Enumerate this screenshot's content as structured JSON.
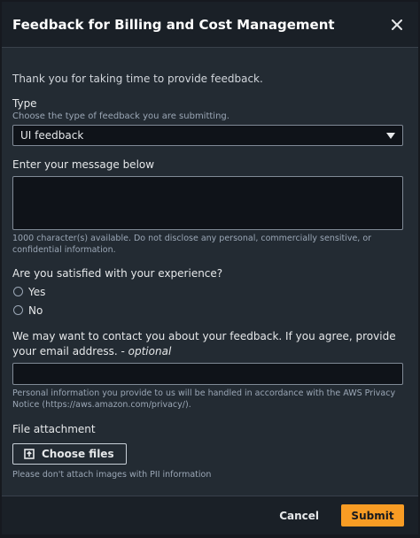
{
  "dialog": {
    "title": "Feedback for Billing and Cost Management",
    "intro": "Thank you for taking time to provide feedback."
  },
  "type_field": {
    "label": "Type",
    "description": "Choose the type of feedback you are submitting.",
    "selected": "UI feedback"
  },
  "message_field": {
    "label": "Enter your message below",
    "value": "",
    "hint": "1000 character(s) available. Do not disclose any personal, commercially sensitive, or confidential information."
  },
  "satisfaction": {
    "question": "Are you satisfied with your experience?",
    "options": [
      {
        "label": "Yes",
        "selected": false
      },
      {
        "label": "No",
        "selected": false
      }
    ]
  },
  "contact_field": {
    "label": "We may want to contact you about your feedback. If you agree, provide your email address. -",
    "optional": "optional",
    "value": "",
    "hint": "Personal information you provide to us will be handled in accordance with the AWS Privacy Notice (https://aws.amazon.com/privacy/)."
  },
  "attachment": {
    "label": "File attachment",
    "button": "Choose files",
    "hint": "Please don't attach images with PII information"
  },
  "footer": {
    "cancel": "Cancel",
    "submit": "Submit"
  },
  "colors": {
    "accent": "#f89c24",
    "background": "#232b33",
    "header": "#1a2027"
  },
  "icons": {
    "close": "close-icon",
    "dropdown": "caret-down-icon",
    "upload": "upload-icon"
  }
}
